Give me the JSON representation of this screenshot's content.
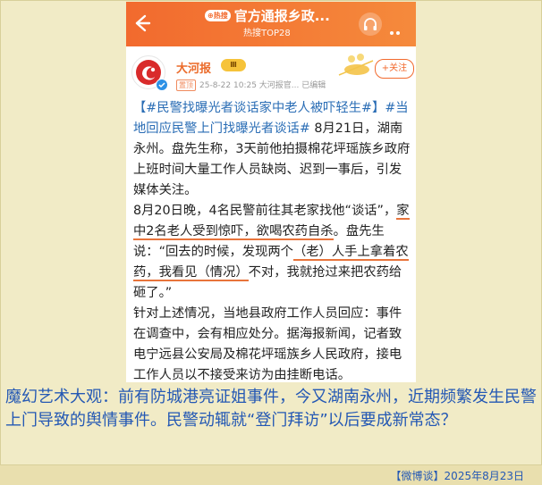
{
  "topbar": {
    "hot_badge": "⊕热搜",
    "topic_title": "官方通报乡政...",
    "topic_sub": "热搜TOP28"
  },
  "author": {
    "name": "大河报",
    "level_badge": "Ⅲ",
    "pin_label": "置顶",
    "meta_text": "25-8-22 10:25  大河报官...  已编辑",
    "follow_label": "+关注"
  },
  "post": {
    "tag1": "【#民警找曝光者谈话家中老人被吓轻生#】",
    "tag2": "#当地回应民警上门找曝光者谈话#",
    "p1_rest": " 8月21日，湖南永州。盘先生称，3天前他拍摄棉花坪瑶族乡政府上班时间大量工作人员缺岗、迟到一事后，引发媒体关注。",
    "p2_a": "8月20日晚，4名民警前往其老家找他“谈话”，",
    "p2_u1": "家中2名老人受到惊吓，欲喝农药自杀",
    "p2_b": "。盘先生说：“回去的时候，发现两个",
    "p2_u2": "（老）人手上拿着农药，我看见（情况）",
    "p2_c": "不对，我就抢过来把农药给砸了。”",
    "p3": "针对上述情况，当地县政府工作人员回应：事件在调查中，会有相应处分。据海报新闻，记者致电宁远县公安局及棉花坪瑶族乡人民政府，接电工作人员以不接受来访为由挂断电话。"
  },
  "comment": {
    "text": "魔幻艺术大观：前有防城港亮证姐事件，今又湖南永州，近期频繁发生民警上门导致的舆情事件。民警动辄就“登门拜访”以后要成新常态？"
  },
  "credit": {
    "text": "【微博谈】2025年8月23日"
  },
  "colors": {
    "accent": "#f26a2e",
    "link": "#2a6db5",
    "comment": "#2458b4",
    "background": "#f1ebc6"
  },
  "icons": {
    "back": "back-arrow-icon",
    "listen": "headphones-icon",
    "more": "more-dots-icon",
    "verified": "verified-badge-icon"
  }
}
